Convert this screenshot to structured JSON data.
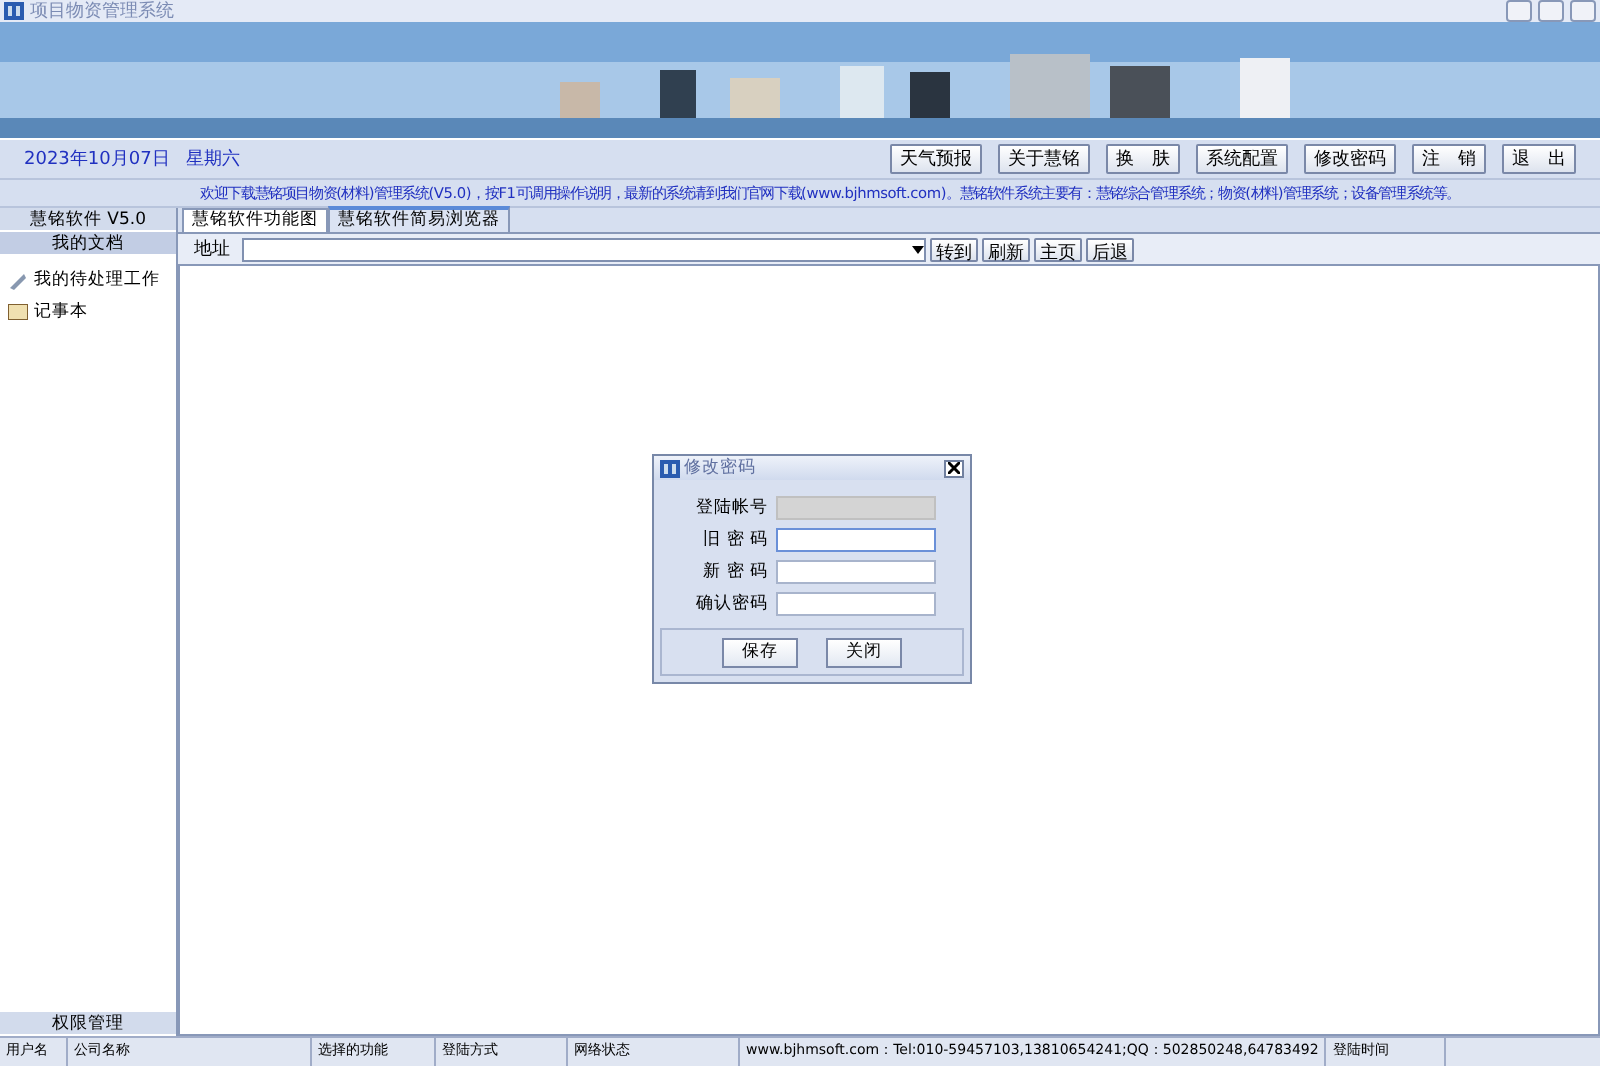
{
  "window": {
    "title": "项目物资管理系统"
  },
  "header": {
    "date": "2023年10月07日",
    "weekday": "星期六",
    "buttons": [
      "天气预报",
      "关于慧铭",
      "换　肤",
      "系统配置",
      "修改密码",
      "注　销",
      "退　出"
    ]
  },
  "notice": "欢迎下载慧铭项目物资(材料)管理系统(V5.0)，按F1可调用操作说明，最新的系统请到我们官网下载(www.bjhmsoft.com)。慧铭软件系统主要有：慧铭综合管理系统；物资(材料)管理系统；设备管理系统等。",
  "sidebar": {
    "sections": [
      {
        "label": "慧铭软件 V5.0",
        "selected": false
      },
      {
        "label": "我的文档",
        "selected": true
      }
    ],
    "items": [
      {
        "label": "我的待处理工作",
        "kind": "tasks"
      },
      {
        "label": "记事本",
        "kind": "notepad"
      }
    ],
    "footer": "权限管理"
  },
  "tabs": [
    {
      "label": "慧铭软件功能图",
      "selected": false
    },
    {
      "label": "慧铭软件简易浏览器",
      "selected": true
    }
  ],
  "browser": {
    "address_label": "地址",
    "buttons": [
      "转到",
      "刷新",
      "主页",
      "后退"
    ]
  },
  "dialog": {
    "title": "修改密码",
    "fields": [
      {
        "label": "登陆帐号",
        "disabled": true,
        "focused": false
      },
      {
        "label": "旧 密 码",
        "disabled": false,
        "focused": true
      },
      {
        "label": "新 密 码",
        "disabled": false,
        "focused": false
      },
      {
        "label": "确认密码",
        "disabled": false,
        "focused": false
      }
    ],
    "buttons": [
      "保存",
      "关闭"
    ]
  },
  "status_bar": [
    "用户名",
    "公司名称",
    "选择的功能",
    "登陆方式",
    "网络状态",
    "www.bjhmsoft.com：Tel:010-59457103,13810654241;QQ：502850248,64783492",
    "登陆时间"
  ]
}
